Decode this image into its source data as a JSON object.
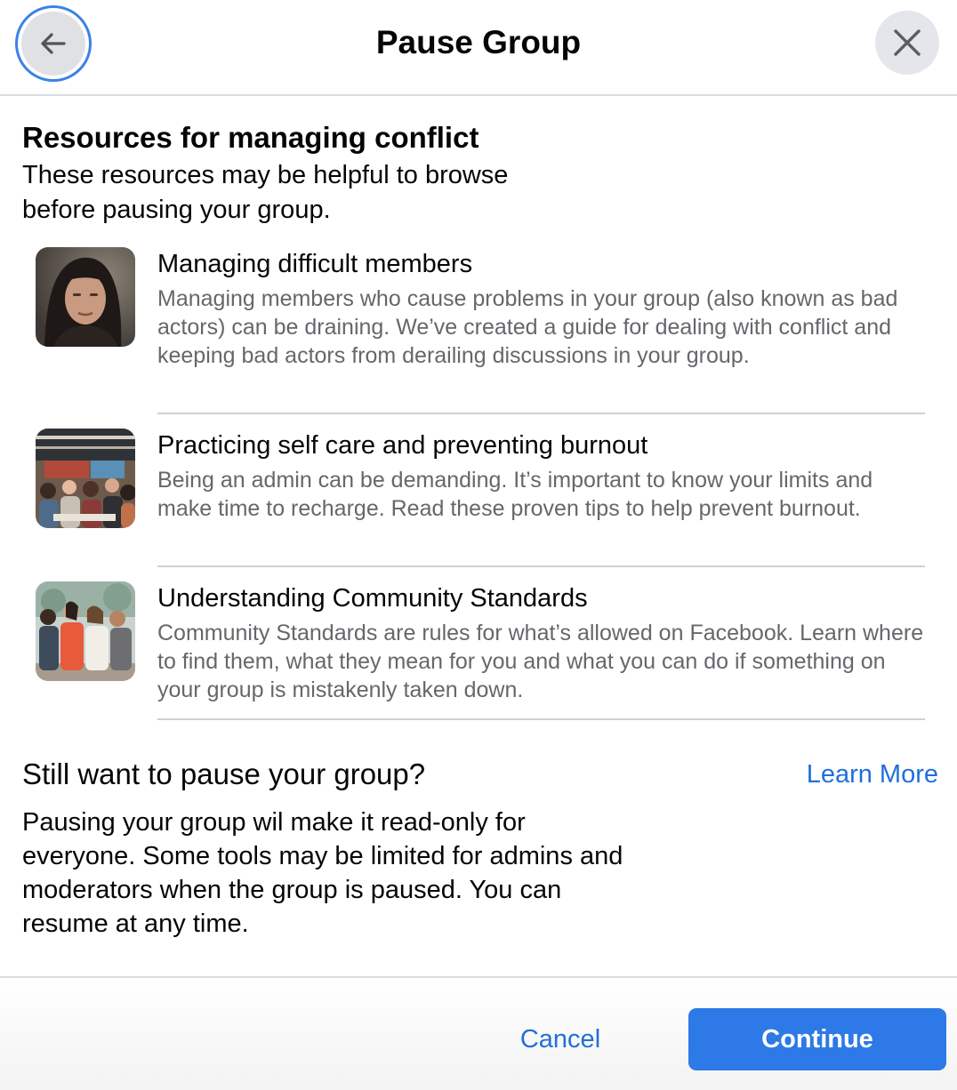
{
  "header": {
    "title": "Pause Group",
    "back_icon": "arrow-left-icon",
    "close_icon": "close-icon"
  },
  "resources_section": {
    "heading": "Resources for managing conflict",
    "subtext": "These resources may be helpful to browse before pausing your group.",
    "items": [
      {
        "title": "Managing difficult members",
        "description": "Managing members who cause problems in your group (also known as bad actors) can be draining. We’ve created a guide for dealing with conflict and keeping bad actors from derailing discussions in your group."
      },
      {
        "title": "Practicing self care and preventing burnout",
        "description": "Being an admin can be demanding. It’s important to know your limits and make time to recharge. Read these proven tips to help prevent burnout."
      },
      {
        "title": "Understanding Community Standards",
        "description": "Community Standards are rules for what’s allowed on Facebook. Learn where to find them, what they mean for you and what you can do if something on your group is mistakenly taken down."
      }
    ]
  },
  "pause_section": {
    "heading": "Still want to pause your group?",
    "learn_more": "Learn More",
    "description": "Pausing your group wil make it read-only for everyone. Some tools may be limited for admins and moderators when the group is paused. You can resume at any time."
  },
  "footer": {
    "cancel_label": "Cancel",
    "continue_label": "Continue"
  },
  "colors": {
    "accent": "#2d79e7",
    "link": "#216fdb",
    "secondary_text": "#65676b"
  }
}
